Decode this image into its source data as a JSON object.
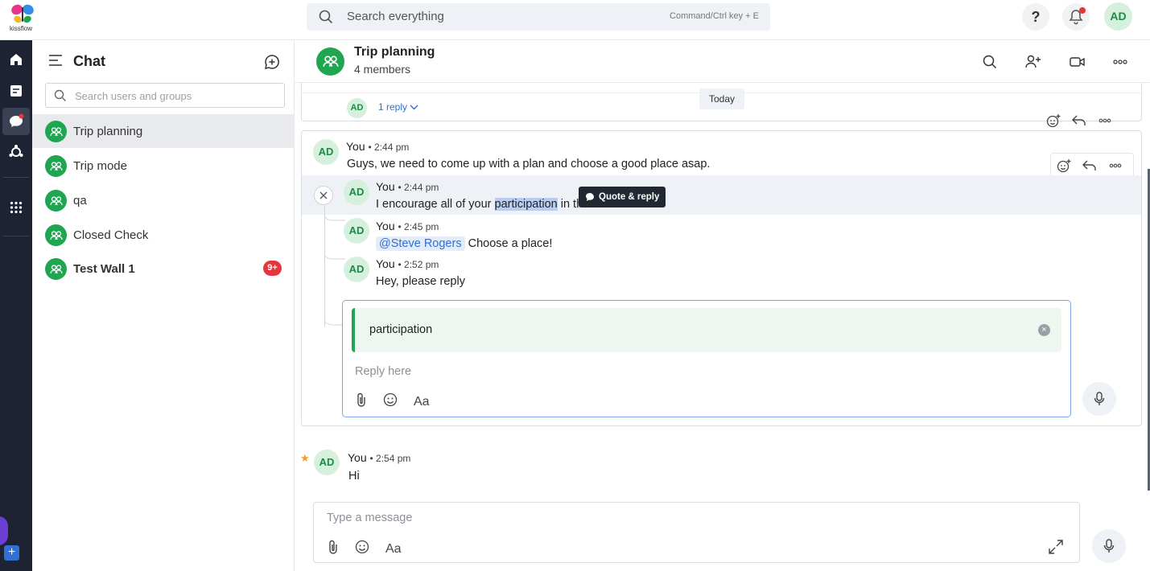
{
  "app": {
    "logo_text": "kissflow"
  },
  "topbar": {
    "search_placeholder": "Search everything",
    "search_hint": "Command/Ctrl key + E",
    "help_label": "?",
    "avatar": "AD"
  },
  "rail": {
    "items": [
      "home-icon",
      "tasks-icon",
      "chat-icon",
      "integrations-icon",
      "apps-grid-icon"
    ],
    "plus": "+"
  },
  "chat_panel": {
    "title": "Chat",
    "search_placeholder": "Search users and groups",
    "items": [
      {
        "name": "Trip planning",
        "active": true,
        "bold": false
      },
      {
        "name": "Trip mode",
        "active": false,
        "bold": false
      },
      {
        "name": "qa",
        "active": false,
        "bold": false
      },
      {
        "name": "Closed Check",
        "active": false,
        "bold": false
      },
      {
        "name": "Test Wall 1",
        "active": false,
        "bold": true,
        "badge": "9+"
      }
    ]
  },
  "conversation": {
    "title": "Trip planning",
    "subtitle": "4 members",
    "date_divider": "Today",
    "prev_thread": {
      "avatar": "AD",
      "reply_link": "1 reply"
    },
    "main_message": {
      "avatar": "AD",
      "sender": "You",
      "time": "• 2:44 pm",
      "text": "Guys, we need to come up with a plan and choose a good place asap."
    },
    "replies": [
      {
        "avatar": "AD",
        "sender": "You",
        "time": "• 2:44 pm",
        "text_before": "I encourage all of your ",
        "text_selected": "participation",
        "text_after": " in this."
      },
      {
        "avatar": "AD",
        "sender": "You",
        "time": "• 2:45 pm",
        "mention": "@Steve Rogers",
        "text": " Choose a place!"
      },
      {
        "avatar": "AD",
        "sender": "You",
        "time": "• 2:52 pm",
        "text": "Hey, please reply"
      }
    ],
    "tooltip": "Quote & reply",
    "reply_box": {
      "quote": "participation",
      "placeholder": "Reply here",
      "format_label": "Aa"
    },
    "last_message": {
      "avatar": "AD",
      "sender": "You",
      "time": "• 2:54 pm",
      "text": "Hi"
    },
    "composer": {
      "placeholder": "Type a message",
      "format_label": "Aa"
    }
  },
  "colors": {
    "accent_green": "#20a651",
    "link_blue": "#2f6fd6",
    "rail_dark": "#1e2333",
    "badge_red": "#e6353d"
  }
}
